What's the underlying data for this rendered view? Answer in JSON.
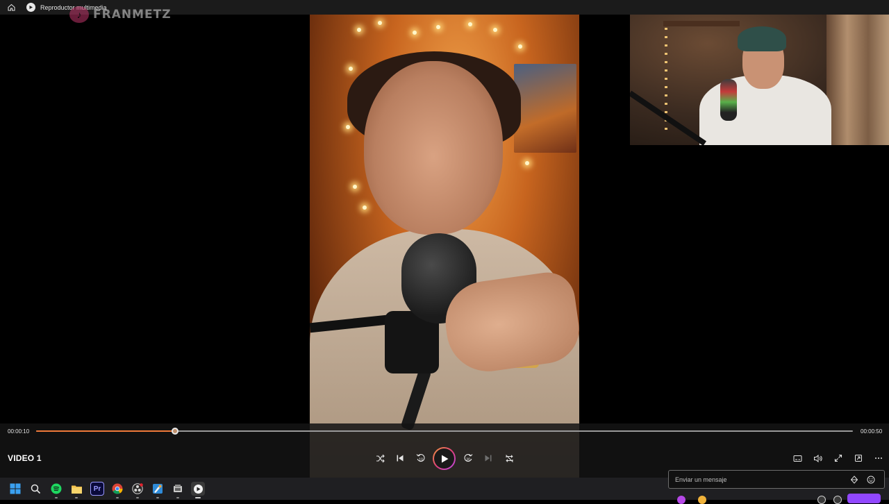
{
  "titlebar": {
    "app_title": "Reproductor multimedia"
  },
  "watermark": {
    "text": "FRANMETZ"
  },
  "player": {
    "current_time": "00:00:10",
    "total_time": "00:00:50",
    "progress": 0.17,
    "video_title": "VIDEO 1",
    "accent_color": "#f07a3a"
  },
  "controls": {
    "shuffle_icon": "shuffle-icon",
    "previous_icon": "skip-previous-icon",
    "rewind_icon": "rewind-10-icon",
    "rewind_label": "10",
    "play_icon": "play-icon",
    "forward_icon": "forward-30-icon",
    "forward_label": "30",
    "next_icon": "skip-next-icon",
    "repeat_icon": "repeat-off-icon",
    "right": [
      "subtitles-icon",
      "volume-icon",
      "fullscreen-icon",
      "miniplayer-icon",
      "more-icon"
    ]
  },
  "taskbar": {
    "apps": [
      "windows-start",
      "search",
      "spotify",
      "file-explorer",
      "premiere-pro",
      "chrome",
      "obs",
      "paint",
      "app",
      "media-player"
    ],
    "premiere_label": "Pr"
  },
  "chat": {
    "placeholder": "Enviar un mensaje",
    "brand_color": "#9147ff"
  }
}
